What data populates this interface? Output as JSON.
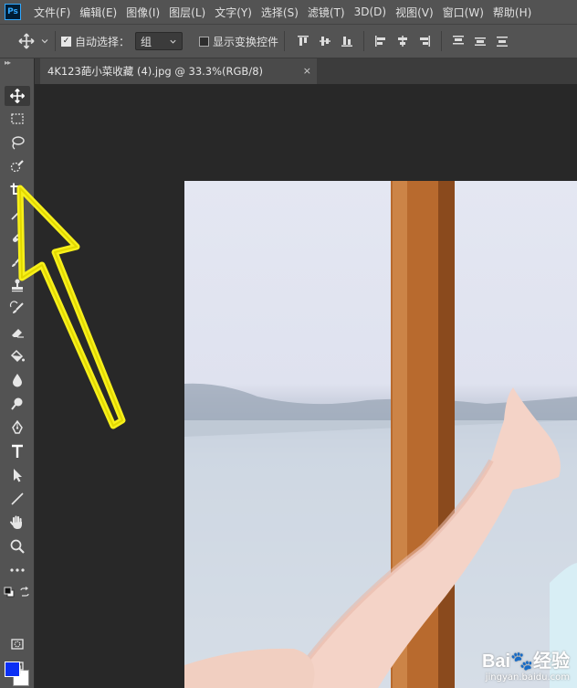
{
  "app": {
    "logo": "Ps"
  },
  "menu": {
    "items": [
      "文件(F)",
      "编辑(E)",
      "图像(I)",
      "图层(L)",
      "文字(Y)",
      "选择(S)",
      "滤镜(T)",
      "3D(D)",
      "视图(V)",
      "窗口(W)",
      "帮助(H)"
    ]
  },
  "options": {
    "auto_select_label": "自动选择：",
    "auto_select_checked": true,
    "auto_select_value": "组",
    "show_transform_label": "显示变换控件",
    "show_transform_checked": false
  },
  "document": {
    "tab_title": "4K123葩小菜收藏 (4).jpg @ 33.3%(RGB/8)",
    "close_symbol": "×"
  },
  "tools": [
    "move-tool",
    "marquee-tool",
    "lasso-tool",
    "quick-select-tool",
    "crop-tool",
    "eyedropper-tool",
    "healing-brush-tool",
    "brush-tool",
    "clone-stamp-tool",
    "history-brush-tool",
    "eraser-tool",
    "paint-bucket-tool",
    "blur-tool",
    "dodge-tool",
    "pen-tool",
    "type-tool",
    "path-select-tool",
    "line-tool",
    "hand-tool",
    "zoom-tool",
    "more-tools"
  ],
  "colors": {
    "foreground": "#0a2ff5",
    "background": "#ffffff",
    "annotation_arrow": "#f7f01a"
  },
  "watermark": {
    "logo_a": "Bai",
    "logo_b": "经验",
    "url": "jingyan.baidu.com"
  }
}
